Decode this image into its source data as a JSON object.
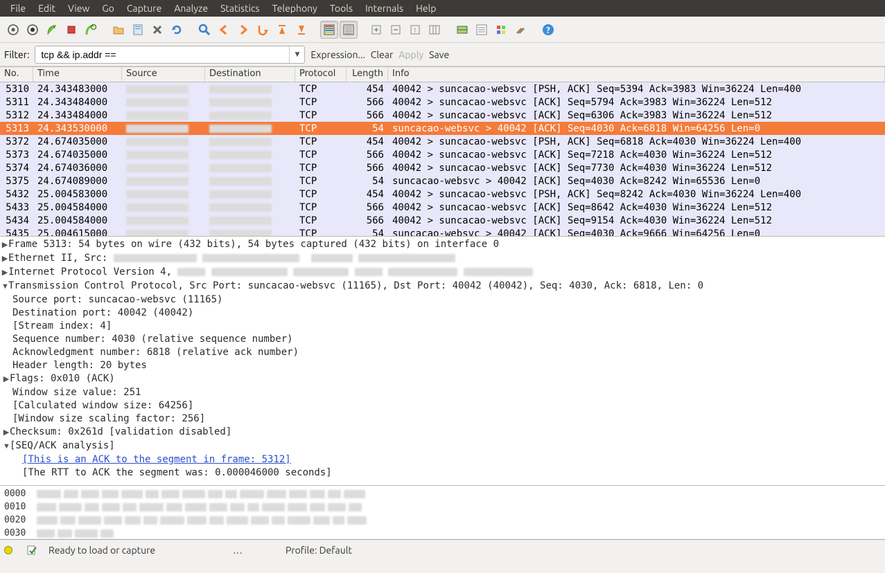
{
  "menubar": [
    "File",
    "Edit",
    "View",
    "Go",
    "Capture",
    "Analyze",
    "Statistics",
    "Telephony",
    "Tools",
    "Internals",
    "Help"
  ],
  "toolbar_icons": [
    "capture-options-icon",
    "capture-interfaces-icon",
    "start-capture-icon",
    "stop-capture-icon",
    "restart-capture-icon",
    "",
    "open-file-icon",
    "save-file-icon",
    "close-icon",
    "reload-icon",
    "",
    "find-icon",
    "go-back-icon",
    "go-forward-icon",
    "go-to-packet-icon",
    "first-packet-icon",
    "last-packet-icon",
    "",
    "colorize-icon",
    "auto-scroll-icon",
    "",
    "zoom-in-icon",
    "zoom-out-icon",
    "zoom-reset-icon",
    "resize-columns-icon",
    "",
    "capture-filters-icon",
    "display-filters-icon",
    "coloring-rules-icon",
    "preferences-icon",
    "",
    "help-icon"
  ],
  "filter": {
    "label": "Filter:",
    "value": "tcp && ip.addr ==",
    "links": {
      "expression": "Expression...",
      "clear": "Clear",
      "apply": "Apply",
      "save": "Save"
    }
  },
  "columns": {
    "no": "No.",
    "time": "Time",
    "src": "Source",
    "dst": "Destination",
    "proto": "Protocol",
    "len": "Length",
    "info": "Info"
  },
  "packets": [
    {
      "no": "5310",
      "time": "24.343483000",
      "proto": "TCP",
      "len": "454",
      "info": "40042 > suncacao-websvc [PSH, ACK] Seq=5394 Ack=3983 Win=36224 Len=400",
      "sel": false
    },
    {
      "no": "5311",
      "time": "24.343484000",
      "proto": "TCP",
      "len": "566",
      "info": "40042 > suncacao-websvc [ACK] Seq=5794 Ack=3983 Win=36224 Len=512",
      "sel": false
    },
    {
      "no": "5312",
      "time": "24.343484000",
      "proto": "TCP",
      "len": "566",
      "info": "40042 > suncacao-websvc [ACK] Seq=6306 Ack=3983 Win=36224 Len=512",
      "sel": false
    },
    {
      "no": "5313",
      "time": "24.343530000",
      "proto": "TCP",
      "len": "54",
      "info": "suncacao-websvc > 40042 [ACK] Seq=4030 Ack=6818 Win=64256 Len=0",
      "sel": true
    },
    {
      "no": "5372",
      "time": "24.674035000",
      "proto": "TCP",
      "len": "454",
      "info": "40042 > suncacao-websvc [PSH, ACK] Seq=6818 Ack=4030 Win=36224 Len=400",
      "sel": false
    },
    {
      "no": "5373",
      "time": "24.674035000",
      "proto": "TCP",
      "len": "566",
      "info": "40042 > suncacao-websvc [ACK] Seq=7218 Ack=4030 Win=36224 Len=512",
      "sel": false
    },
    {
      "no": "5374",
      "time": "24.674036000",
      "proto": "TCP",
      "len": "566",
      "info": "40042 > suncacao-websvc [ACK] Seq=7730 Ack=4030 Win=36224 Len=512",
      "sel": false
    },
    {
      "no": "5375",
      "time": "24.674089000",
      "proto": "TCP",
      "len": "54",
      "info": "suncacao-websvc > 40042 [ACK] Seq=4030 Ack=8242 Win=65536 Len=0",
      "sel": false
    },
    {
      "no": "5432",
      "time": "25.004583000",
      "proto": "TCP",
      "len": "454",
      "info": "40042 > suncacao-websvc [PSH, ACK] Seq=8242 Ack=4030 Win=36224 Len=400",
      "sel": false
    },
    {
      "no": "5433",
      "time": "25.004584000",
      "proto": "TCP",
      "len": "566",
      "info": "40042 > suncacao-websvc [ACK] Seq=8642 Ack=4030 Win=36224 Len=512",
      "sel": false
    },
    {
      "no": "5434",
      "time": "25.004584000",
      "proto": "TCP",
      "len": "566",
      "info": "40042 > suncacao-websvc [ACK] Seq=9154 Ack=4030 Win=36224 Len=512",
      "sel": false
    },
    {
      "no": "5435",
      "time": "25.004615000",
      "proto": "TCP",
      "len": "54",
      "info": "suncacao-websvc > 40042 [ACK] Seq=4030 Ack=9666 Win=64256 Len=0",
      "sel": false
    }
  ],
  "tree": {
    "frame": "Frame 5313: 54 bytes on wire (432 bits), 54 bytes captured (432 bits) on interface 0",
    "eth_prefix": "Ethernet II, Src: ",
    "ip_prefix": "Internet Protocol Version 4, ",
    "tcp": "Transmission Control Protocol, Src Port: suncacao-websvc (11165), Dst Port: 40042 (40042), Seq: 4030, Ack: 6818, Len: 0",
    "details": [
      "Source port: suncacao-websvc (11165)",
      "Destination port: 40042 (40042)",
      "[Stream index: 4]",
      "Sequence number: 4030    (relative sequence number)",
      "Acknowledgment number: 6818    (relative ack number)",
      "Header length: 20 bytes"
    ],
    "flags": "Flags: 0x010 (ACK)",
    "details2": [
      "Window size value: 251",
      "[Calculated window size: 64256]",
      "[Window size scaling factor: 256]"
    ],
    "checksum": "Checksum: 0x261d [validation disabled]",
    "seqack": "[SEQ/ACK analysis]",
    "ack_link": "[This is an ACK to the segment in frame: 5312]",
    "rtt": "[The RTT to ACK the segment was: 0.000046000 seconds]"
  },
  "bytes_offsets": [
    "0000",
    "0010",
    "0020",
    "0030"
  ],
  "status": {
    "ready": "Ready to load or capture",
    "ellipsis": "…",
    "profile": "Profile: Default"
  }
}
